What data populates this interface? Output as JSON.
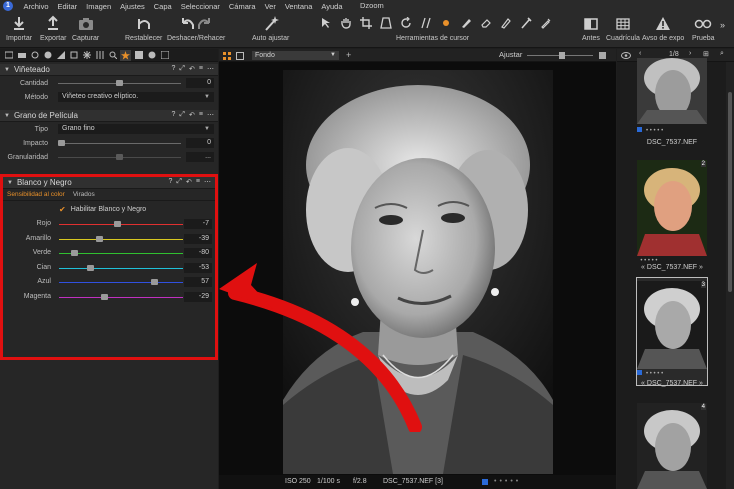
{
  "menu": {
    "items": [
      "Archivo",
      "Editar",
      "Imagen",
      "Ajustes",
      "Capa",
      "Seleccionar",
      "Cámara",
      "Ver",
      "Ventana",
      "Ayuda"
    ],
    "window_title": "Dzoom"
  },
  "toolbar": {
    "import": "Importar",
    "export": "Exportar",
    "capture": "Capturar",
    "reset": "Restablecer",
    "undo_redo": "Deshacer/Rehacer",
    "auto_adjust": "Auto ajustar",
    "cursor_tools": "Herramientas de cursor",
    "before": "Antes",
    "grid": "Cuadrícula",
    "exposure_warning": "Avso de expo",
    "proof": "Prueba"
  },
  "vignette": {
    "title": "Viñeteado",
    "amount_label": "Cantidad",
    "amount_value": "0",
    "amount_level": 0.5,
    "method_label": "Método",
    "method_value": "Viñeteo creativo elíptico."
  },
  "grain": {
    "title": "Grano de Película",
    "type_label": "Tipo",
    "type_value": "Grano fino",
    "impact_label": "Impacto",
    "impact_value": "0",
    "granularity_label": "Granularidad",
    "granularity_value": "..."
  },
  "bw": {
    "title": "Blanco y Negro",
    "tab_sensitivity": "Sensibilidad al color",
    "tab_split": "Virados",
    "enable_label": "Habilitar Blanco y Negro",
    "sliders": [
      {
        "label": "Rojo",
        "value": "-7",
        "level": 0.47,
        "color": "#e03030"
      },
      {
        "label": "Amarillo",
        "value": "-39",
        "level": 0.31,
        "color": "#d8c820"
      },
      {
        "label": "Verde",
        "value": "-80",
        "level": 0.1,
        "color": "#30c030"
      },
      {
        "label": "Cian",
        "value": "-53",
        "level": 0.24,
        "color": "#20c0d8"
      },
      {
        "label": "Azul",
        "value": "57",
        "level": 0.78,
        "color": "#3050e0"
      },
      {
        "label": "Magenta",
        "value": "-29",
        "level": 0.36,
        "color": "#c030c0"
      }
    ]
  },
  "viewer": {
    "background_select": "Fondo",
    "adjust_label": "Ajustar",
    "iso": "ISO 250",
    "shutter": "1/100 s",
    "aperture": "f/2.8",
    "filename": "DSC_7537.NEF [3]"
  },
  "browser": {
    "counter": "1/8",
    "items": [
      {
        "name": "DSC_7537.NEF",
        "number": ""
      },
      {
        "name": "DSC_7537.NEF",
        "number": "2"
      },
      {
        "name": "DSC_7537.NEF",
        "number": "3"
      },
      {
        "name": "",
        "number": "4"
      }
    ]
  },
  "colors": {
    "accent_orange": "#e8902a",
    "highlight_red": "#e01010"
  }
}
